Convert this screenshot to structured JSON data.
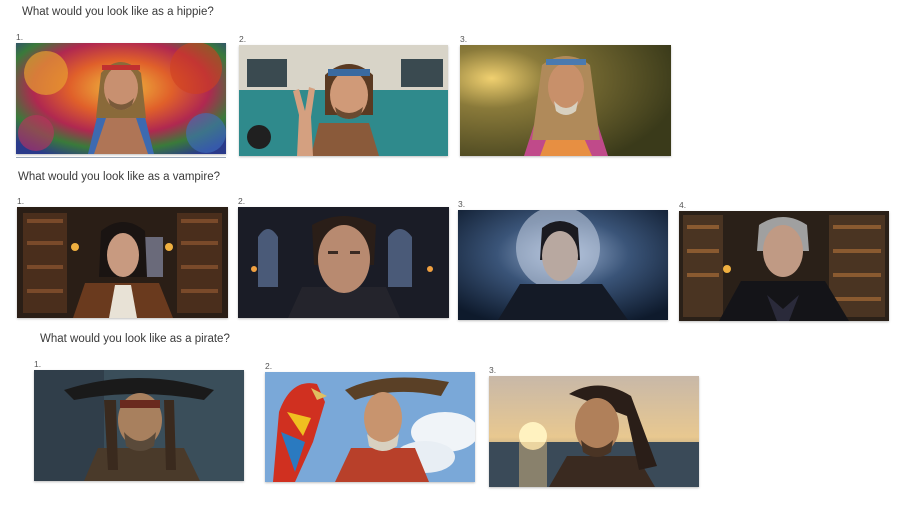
{
  "sections": [
    {
      "heading": "What would you look like as a hippie?",
      "items": [
        {
          "number": "1.",
          "subject": "hippie-portrait-psychedelic-backdrop"
        },
        {
          "number": "2.",
          "subject": "hippie-peace-sign-van"
        },
        {
          "number": "3.",
          "subject": "hippie-sunset-portrait"
        }
      ]
    },
    {
      "heading": "What would you look like as a vampire?",
      "items": [
        {
          "number": "1.",
          "subject": "vampire-library-portrait"
        },
        {
          "number": "2.",
          "subject": "vampire-cathedral-portrait"
        },
        {
          "number": "3.",
          "subject": "vampire-moonlight-portrait"
        },
        {
          "number": "4.",
          "subject": "vampire-elder-library-portrait"
        }
      ]
    },
    {
      "heading": "What would you look like as a pirate?",
      "items": [
        {
          "number": "1.",
          "subject": "pirate-captain-portrait"
        },
        {
          "number": "2.",
          "subject": "pirate-with-parrot-portrait"
        },
        {
          "number": "3.",
          "subject": "pirate-sunset-sea-portrait"
        }
      ]
    }
  ],
  "colors": {
    "background": "#ffffff",
    "divider": "#9aa7b8"
  }
}
